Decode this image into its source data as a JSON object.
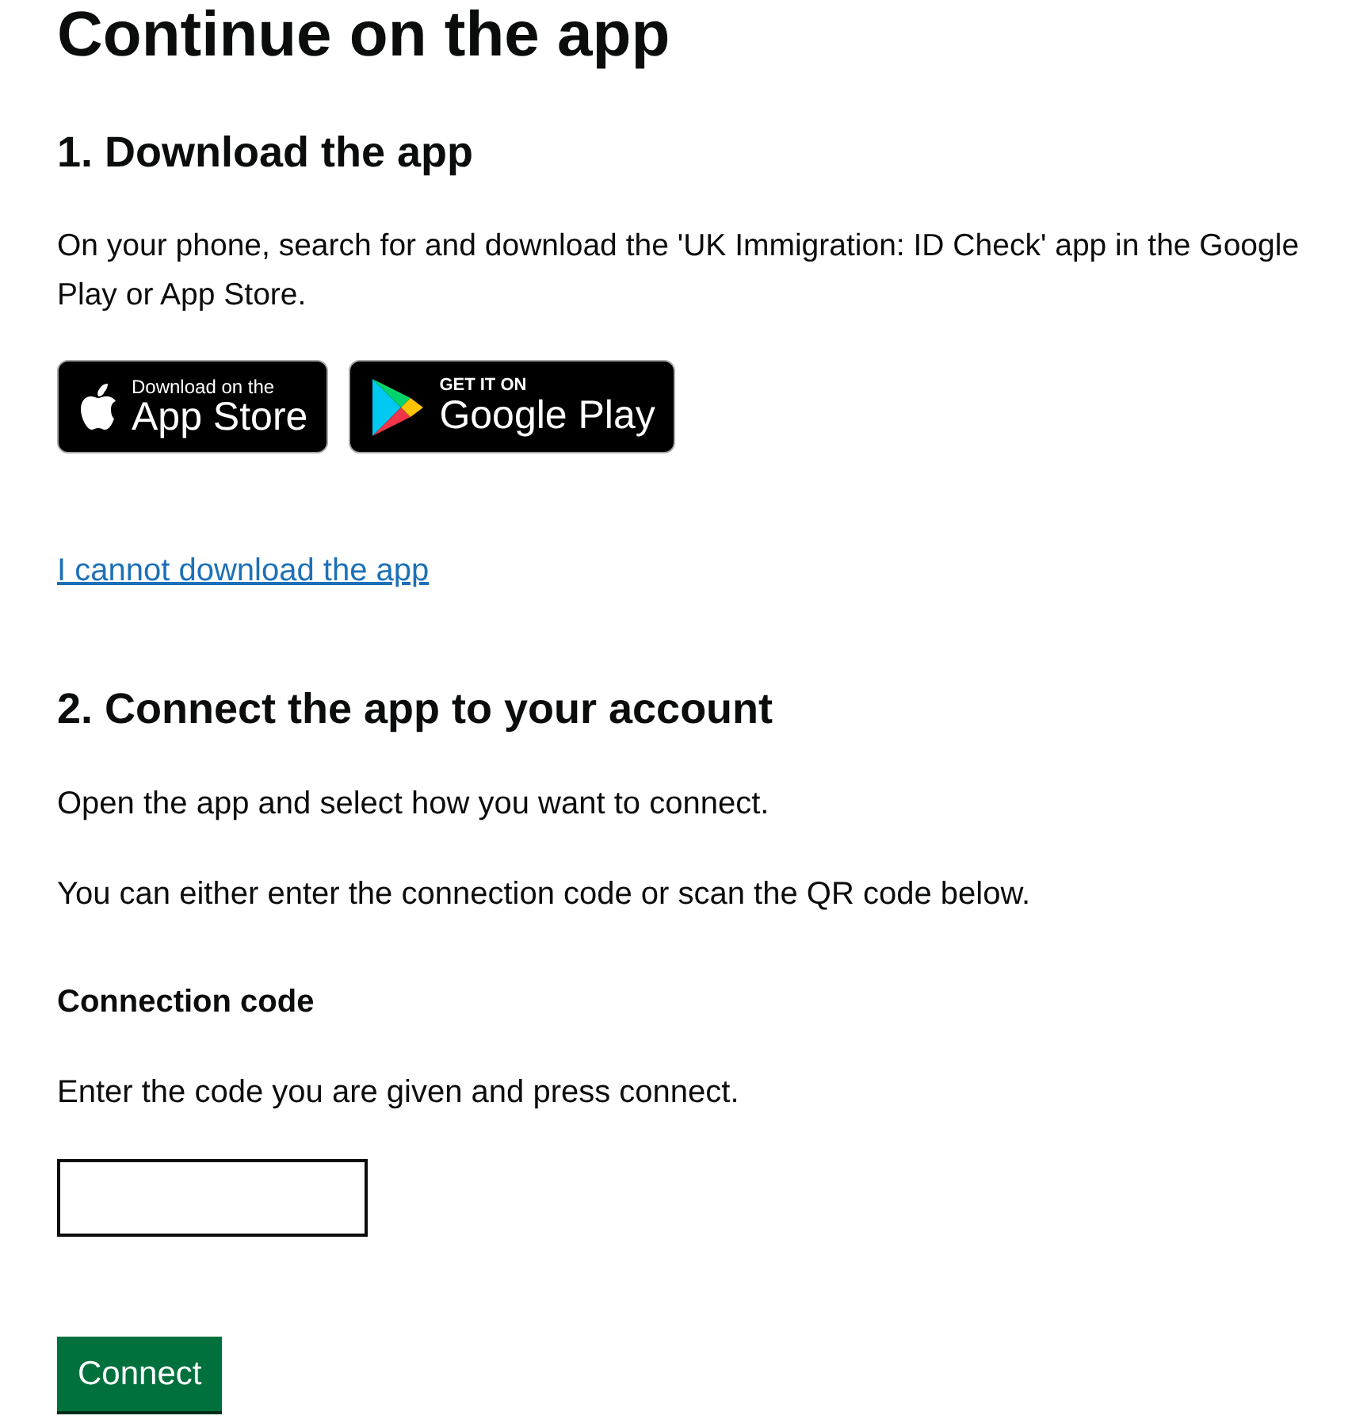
{
  "title": "Continue on the app",
  "step1": {
    "heading": "1. Download the app",
    "text": "On your phone, search for and download the 'UK Immigration: ID Check' app in the Google Play or App Store.",
    "badges": [
      {
        "kind": "app-store",
        "small": "Download on the",
        "large": "App Store"
      },
      {
        "kind": "google-play",
        "small": "GET IT ON",
        "large": "Google Play"
      }
    ],
    "link": "I cannot download the app"
  },
  "step2": {
    "heading": "2. Connect the app to your account",
    "paragraphs": [
      "Open the app and select how you want to connect.",
      "You can either enter the connection code or scan the QR code below."
    ],
    "field": {
      "label": "Connection code",
      "hint": "Enter the code you are given and press connect."
    },
    "button": "Connect"
  }
}
